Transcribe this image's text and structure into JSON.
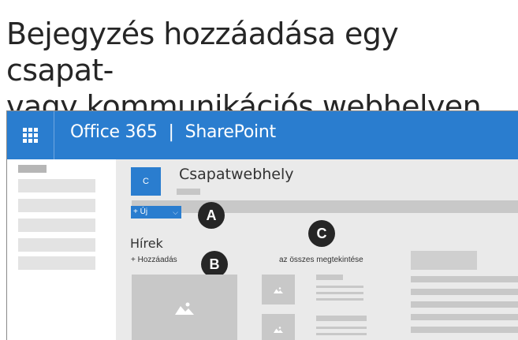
{
  "heading": {
    "line1": "Bejegyzés hozzáadása egy csapat-",
    "line2": "vagy kommunikációs webhelyen"
  },
  "topbar": {
    "app_name": "Office 365",
    "separator": "|",
    "product": "SharePoint",
    "waffle_icon": "app-launcher-icon",
    "color": "#2a7dcf"
  },
  "site": {
    "logo_letter": "C",
    "title": "Csapatwebhely"
  },
  "command_bar": {
    "new_label": "+ Új",
    "new_chevron": "⌵"
  },
  "news": {
    "title": "Hírek",
    "add_label": "+ Hozzáadás",
    "see_all_label": "az összes megtekintése"
  },
  "callouts": {
    "a": "A",
    "b": "B",
    "c": "C"
  },
  "colors": {
    "accent": "#2a7dcf",
    "callout": "#262626",
    "canvas": "#eaeaea",
    "placeholder": "#c8c8c8"
  }
}
